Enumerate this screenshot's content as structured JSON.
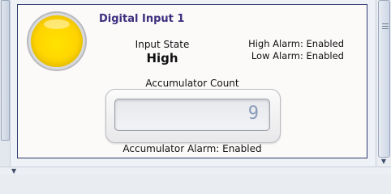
{
  "panel": {
    "title": "Digital Input 1",
    "indicator": {
      "state_color": "#ffd400",
      "icon": "indicator-lamp-icon"
    },
    "input_state": {
      "label": "Input State",
      "value": "High"
    },
    "alarms": {
      "high": "High Alarm: Enabled",
      "low": "Low Alarm: Enabled"
    },
    "accumulator": {
      "label": "Accumulator Count",
      "value": "9",
      "alarm": "Accumulator Alarm: Enabled"
    }
  },
  "scrollbars": {
    "right_arrow_icon": "chevron-down-icon",
    "bottom_caret_icon": "chevron-down-icon"
  }
}
